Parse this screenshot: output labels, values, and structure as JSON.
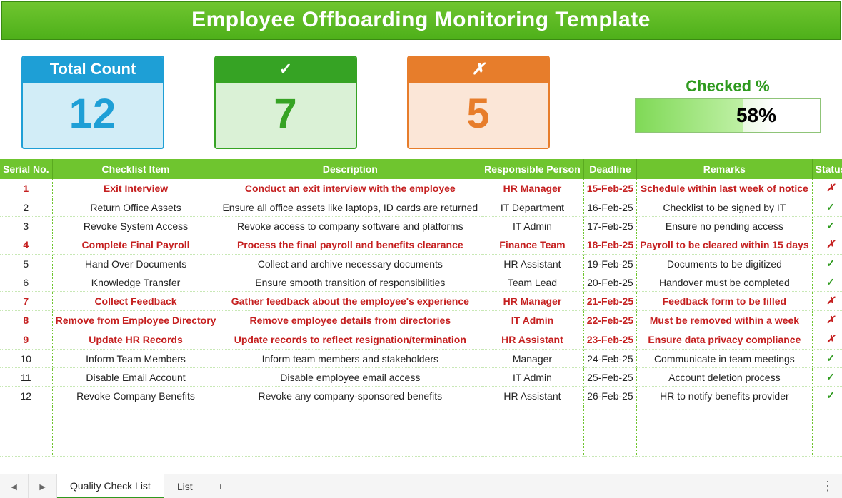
{
  "title": "Employee Offboarding Monitoring Template",
  "summary": {
    "total_label": "Total Count",
    "total_value": "12",
    "done_symbol": "✓",
    "done_value": "7",
    "pending_symbol": "✗",
    "pending_value": "5",
    "checked_label": "Checked %",
    "checked_percent": "58%"
  },
  "columns": {
    "serial": "Serial No.",
    "item": "Checklist Item",
    "desc": "Description",
    "resp": "Responsible Person",
    "dead": "Deadline",
    "rem": "Remarks",
    "stat": "Status"
  },
  "rows": [
    {
      "serial": "1",
      "item": "Exit Interview",
      "desc": "Conduct an exit interview with the employee",
      "resp": "HR Manager",
      "dead": "15-Feb-25",
      "rem": "Schedule within last week of notice",
      "status": "pending"
    },
    {
      "serial": "2",
      "item": "Return Office Assets",
      "desc": "Ensure all office assets like laptops, ID cards are returned",
      "resp": "IT Department",
      "dead": "16-Feb-25",
      "rem": "Checklist to be signed by IT",
      "status": "done"
    },
    {
      "serial": "3",
      "item": "Revoke System Access",
      "desc": "Revoke access to company software and platforms",
      "resp": "IT Admin",
      "dead": "17-Feb-25",
      "rem": "Ensure no pending access",
      "status": "done"
    },
    {
      "serial": "4",
      "item": "Complete Final Payroll",
      "desc": "Process the final payroll and benefits clearance",
      "resp": "Finance Team",
      "dead": "18-Feb-25",
      "rem": "Payroll to be cleared within 15 days",
      "status": "pending"
    },
    {
      "serial": "5",
      "item": "Hand Over Documents",
      "desc": "Collect and archive necessary documents",
      "resp": "HR Assistant",
      "dead": "19-Feb-25",
      "rem": "Documents to be digitized",
      "status": "done"
    },
    {
      "serial": "6",
      "item": "Knowledge Transfer",
      "desc": "Ensure smooth transition of responsibilities",
      "resp": "Team Lead",
      "dead": "20-Feb-25",
      "rem": "Handover must be completed",
      "status": "done"
    },
    {
      "serial": "7",
      "item": "Collect Feedback",
      "desc": "Gather feedback about the employee's experience",
      "resp": "HR Manager",
      "dead": "21-Feb-25",
      "rem": "Feedback form to be filled",
      "status": "pending"
    },
    {
      "serial": "8",
      "item": "Remove from Employee Directory",
      "desc": "Remove employee details from directories",
      "resp": "IT Admin",
      "dead": "22-Feb-25",
      "rem": "Must be removed within a week",
      "status": "pending"
    },
    {
      "serial": "9",
      "item": "Update HR Records",
      "desc": "Update records to reflect resignation/termination",
      "resp": "HR Assistant",
      "dead": "23-Feb-25",
      "rem": "Ensure data privacy compliance",
      "status": "pending"
    },
    {
      "serial": "10",
      "item": "Inform Team Members",
      "desc": "Inform team members and stakeholders",
      "resp": "Manager",
      "dead": "24-Feb-25",
      "rem": "Communicate in team meetings",
      "status": "done"
    },
    {
      "serial": "11",
      "item": "Disable Email Account",
      "desc": "Disable employee email access",
      "resp": "IT Admin",
      "dead": "25-Feb-25",
      "rem": "Account deletion process",
      "status": "done"
    },
    {
      "serial": "12",
      "item": "Revoke Company Benefits",
      "desc": "Revoke any company-sponsored benefits",
      "resp": "HR Assistant",
      "dead": "26-Feb-25",
      "rem": "HR to notify benefits provider",
      "status": "done"
    }
  ],
  "status_marks": {
    "done": "✓",
    "pending": "✗"
  },
  "tabs": {
    "active": "Quality Check List",
    "other": "List",
    "add": "+",
    "prev": "◄",
    "next": "►",
    "dots": "⋮"
  }
}
